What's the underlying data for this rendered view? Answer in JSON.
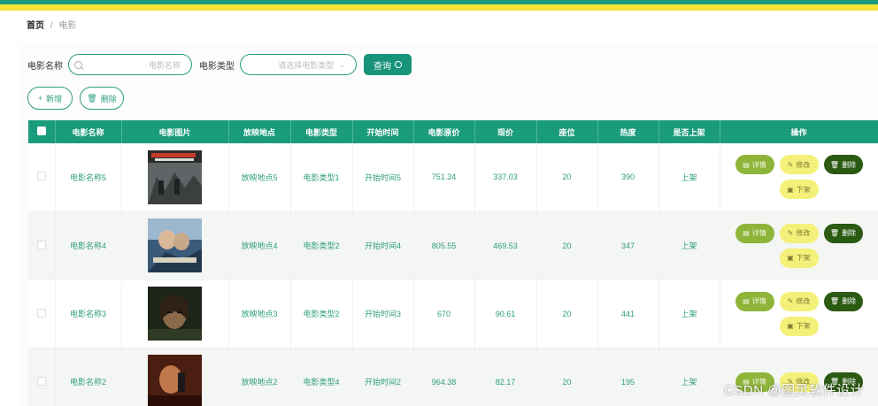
{
  "breadcrumb": {
    "home": "首页",
    "separator": "/",
    "current": "电影"
  },
  "search": {
    "name_label": "电影名称",
    "name_placeholder": "电影名称",
    "type_label": "电影类型",
    "type_placeholder": "请选择电影类型",
    "query_label": "查询"
  },
  "actions": {
    "add_label": "新增",
    "delete_label": "删除"
  },
  "table": {
    "headers": [
      "电影名称",
      "电影图片",
      "放映地点",
      "电影类型",
      "开始时间",
      "电影原价",
      "现价",
      "座位",
      "热度",
      "是否上架",
      "操作"
    ],
    "rows": [
      {
        "name": "电影名称5",
        "poster": "poster-war",
        "location": "放映地点5",
        "type": "电影类型1",
        "start": "开始时间5",
        "orig_price": "751.34",
        "price": "337.03",
        "seats": "20",
        "heat": "390",
        "on_shelf": "上架"
      },
      {
        "name": "电影名称4",
        "poster": "poster-titanic",
        "location": "放映地点4",
        "type": "电影类型2",
        "start": "开始时间4",
        "orig_price": "805.55",
        "price": "469.53",
        "seats": "20",
        "heat": "347",
        "on_shelf": "上架"
      },
      {
        "name": "电影名称3",
        "poster": "poster-woman",
        "location": "放映地点3",
        "type": "电影类型2",
        "start": "开始时间3",
        "orig_price": "670",
        "price": "90.61",
        "seats": "20",
        "heat": "441",
        "on_shelf": "上架"
      },
      {
        "name": "电影名称2",
        "poster": "poster-phone",
        "location": "放映地点2",
        "type": "电影类型4",
        "start": "开始时间2",
        "orig_price": "964.38",
        "price": "82.17",
        "seats": "20",
        "heat": "195",
        "on_shelf": "上架"
      }
    ],
    "op_labels": {
      "detail": "详情",
      "edit": "修改",
      "delete": "删除",
      "offsale": "下架"
    }
  },
  "colors": {
    "primary": "#1a9b7c",
    "accent_yellow": "#f5e33a",
    "detail": "#8fb43a",
    "edit": "#f3f17a",
    "delete": "#2b5a13"
  },
  "watermark": "CSDN @图灵软件设计"
}
